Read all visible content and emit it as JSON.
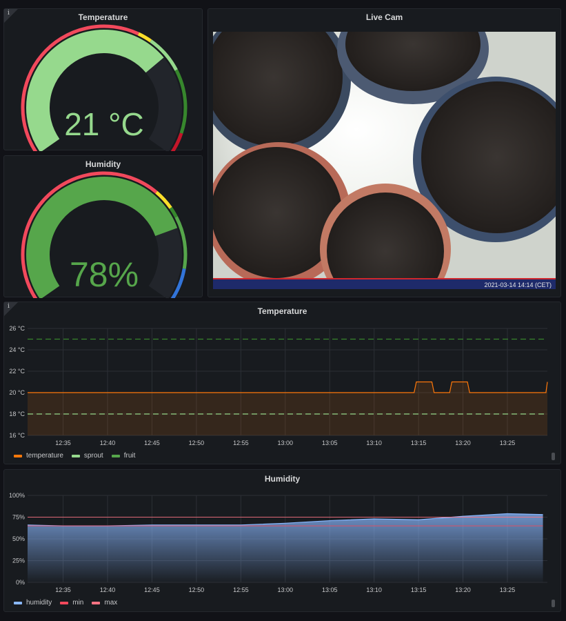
{
  "panels": {
    "temp_gauge": {
      "title": "Temperature",
      "value_text": "21 °C",
      "value": 21,
      "min": 0,
      "max": 30,
      "color": "#96d98d"
    },
    "hum_gauge": {
      "title": "Humidity",
      "value_text": "78%",
      "value": 78,
      "min": 0,
      "max": 100,
      "color": "#56a64b"
    },
    "live_cam": {
      "title": "Live Cam",
      "timestamp": "2021-03-14 14:14 (CET)"
    },
    "temp_graph": {
      "title": "Temperature",
      "legend": [
        {
          "label": "temperature",
          "color": "#ff780a"
        },
        {
          "label": "sprout",
          "color": "#96d98d"
        },
        {
          "label": "fruit",
          "color": "#56a64b"
        }
      ]
    },
    "hum_graph": {
      "title": "Humidity",
      "legend": [
        {
          "label": "humidity",
          "color": "#8ab8ff"
        },
        {
          "label": "min",
          "color": "#f2495c"
        },
        {
          "label": "max",
          "color": "#ff7383"
        }
      ]
    }
  },
  "chart_data": [
    {
      "type": "area",
      "title": "Temperature",
      "x": [
        "12:31",
        "12:35",
        "12:40",
        "12:45",
        "12:50",
        "12:55",
        "13:00",
        "13:05",
        "13:10",
        "13:14:30",
        "13:14:45",
        "13:16:30",
        "13:16:45",
        "13:18:30",
        "13:18:45",
        "13:20:30",
        "13:20:45",
        "13:29:20",
        "13:29:30"
      ],
      "x_ticks": [
        "12:35",
        "12:40",
        "12:45",
        "12:50",
        "12:55",
        "13:00",
        "13:05",
        "13:10",
        "13:15",
        "13:20",
        "13:25"
      ],
      "y_ticks": [
        "16 °C",
        "18 °C",
        "20 °C",
        "22 °C",
        "24 °C",
        "26 °C"
      ],
      "ylim": [
        16,
        26
      ],
      "series": [
        {
          "name": "temperature",
          "values": [
            20,
            20,
            20,
            20,
            20,
            20,
            20,
            20,
            20,
            20,
            21,
            21,
            20,
            20,
            21,
            21,
            20,
            20,
            21
          ]
        }
      ],
      "thresholds": [
        {
          "name": "sprout",
          "value": 18
        },
        {
          "name": "fruit",
          "value": 25
        }
      ]
    },
    {
      "type": "area",
      "title": "Humidity",
      "x": [
        "12:31",
        "12:35",
        "12:40",
        "12:45",
        "12:50",
        "12:55",
        "13:00",
        "13:05",
        "13:10",
        "13:15",
        "13:20",
        "13:25",
        "13:29"
      ],
      "x_ticks": [
        "12:35",
        "12:40",
        "12:45",
        "12:50",
        "12:55",
        "13:00",
        "13:05",
        "13:10",
        "13:15",
        "13:20",
        "13:25"
      ],
      "y_ticks": [
        "0%",
        "25%",
        "50%",
        "75%",
        "100%"
      ],
      "ylim": [
        0,
        100
      ],
      "series": [
        {
          "name": "humidity",
          "values": [
            66,
            65,
            65,
            66,
            66,
            66,
            68,
            71,
            73,
            72,
            76,
            79,
            78
          ]
        },
        {
          "name": "min",
          "values": [
            65,
            65,
            65,
            65,
            65,
            65,
            65,
            65,
            65,
            65,
            65,
            65,
            65
          ]
        },
        {
          "name": "max",
          "values": [
            75,
            75,
            75,
            75,
            75,
            75,
            75,
            75,
            75,
            75,
            75,
            75,
            75
          ]
        }
      ]
    }
  ]
}
